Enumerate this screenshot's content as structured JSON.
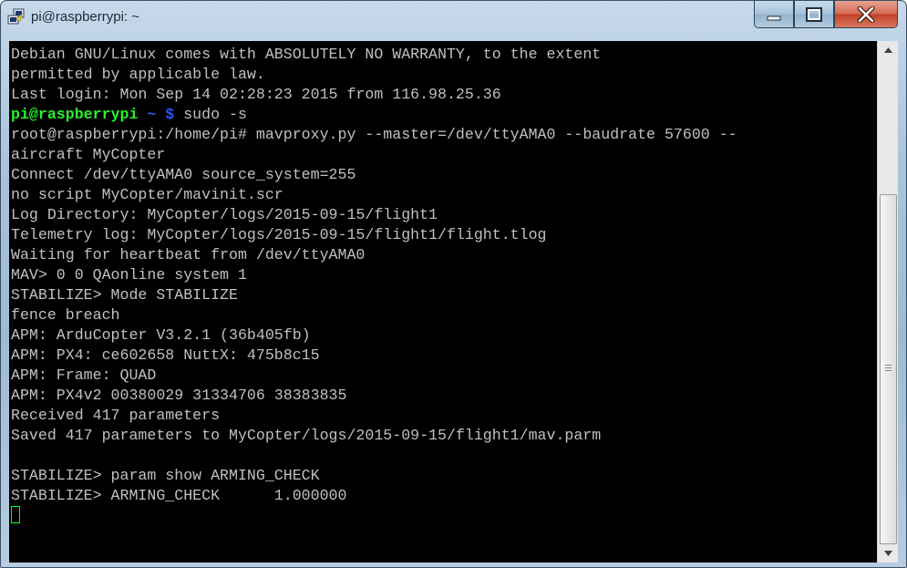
{
  "window": {
    "title": "pi@raspberrypi: ~",
    "icon": "putty-icon",
    "controls": [
      "minimize-icon",
      "maximize-icon",
      "close-icon"
    ]
  },
  "terminal": {
    "colors": {
      "background": "#000000",
      "text": "#c0c0c0",
      "prompt_user": "#29f129",
      "prompt_path": "#2f4ff0",
      "cursor": "#00ff00"
    },
    "lines": [
      "Debian GNU/Linux comes with ABSOLUTELY NO WARRANTY, to the extent",
      "permitted by applicable law.",
      "Last login: Mon Sep 14 02:28:23 2015 from 116.98.25.36",
      "",
      "root@raspberrypi:/home/pi# mavproxy.py --master=/dev/ttyAMA0 --baudrate 57600 --",
      "aircraft MyCopter",
      "Connect /dev/ttyAMA0 source_system=255",
      "no script MyCopter/mavinit.scr",
      "Log Directory: MyCopter/logs/2015-09-15/flight1",
      "Telemetry log: MyCopter/logs/2015-09-15/flight1/flight.tlog",
      "Waiting for heartbeat from /dev/ttyAMA0",
      "MAV> 0 0 QAonline system 1",
      "STABILIZE> Mode STABILIZE",
      "fence breach",
      "APM: ArduCopter V3.2.1 (36b405fb)",
      "APM: PX4: ce602658 NuttX: 475b8c15",
      "APM: Frame: QUAD",
      "APM: PX4v2 00380029 31334706 38383835",
      "Received 417 parameters",
      "Saved 417 parameters to MyCopter/logs/2015-09-15/flight1/mav.parm",
      "",
      "STABILIZE> param show ARMING_CHECK",
      "STABILIZE> ARMING_CHECK      1.000000"
    ],
    "prompt": {
      "user": "pi@raspberrypi",
      "path": " ~ $",
      "command": " sudo -s"
    }
  }
}
